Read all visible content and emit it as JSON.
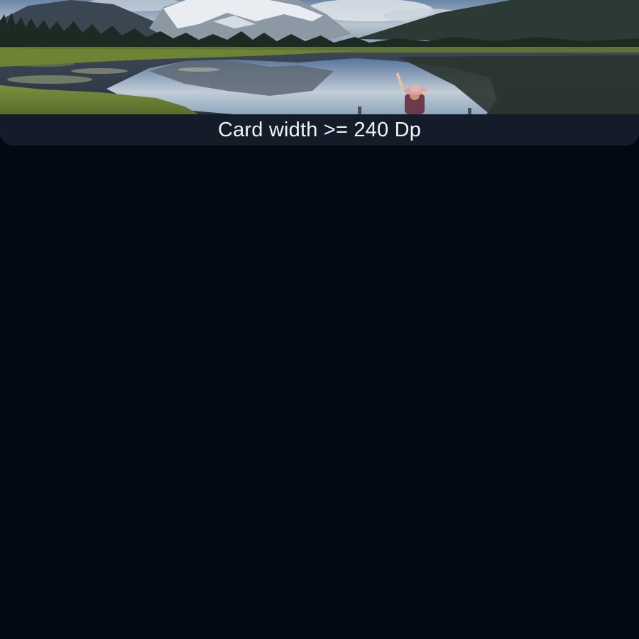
{
  "card": {
    "caption": "Card width >= 240 Dp",
    "image_subject": "mountain-lake-landscape-photo",
    "colors": {
      "background": "#030912",
      "card_surface": "#141c29",
      "caption_text": "#f1f4f8"
    }
  }
}
